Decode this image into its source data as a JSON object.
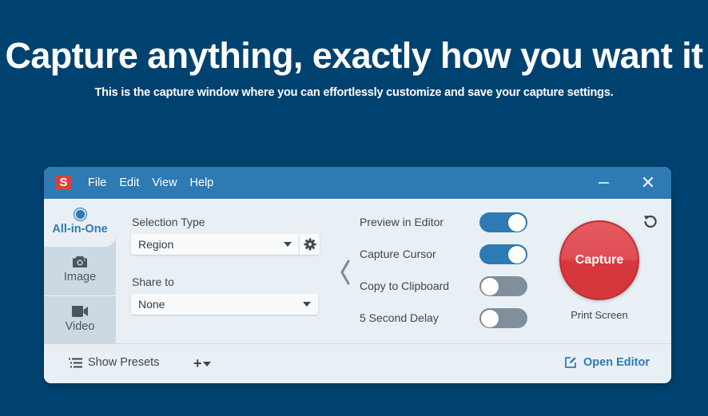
{
  "hero": {
    "title": "Capture anything, exactly how you want it",
    "subtitle": "This is the capture window where you can effortlessly customize and save your capture settings."
  },
  "window": {
    "app_icon": "snagit-logo-icon",
    "app_icon_letter": "S",
    "menu": [
      "File",
      "Edit",
      "View",
      "Help"
    ],
    "controls": {
      "minimize": "minimize-icon",
      "close": "close-icon",
      "close_glyph": "✕"
    }
  },
  "tabs": [
    {
      "label": "All-in-One",
      "icon": "radio-icon",
      "active": true
    },
    {
      "label": "Image",
      "icon": "camera-icon",
      "active": false
    },
    {
      "label": "Video",
      "icon": "video-camera-icon",
      "active": false
    }
  ],
  "settings": {
    "selection_type": {
      "label": "Selection Type",
      "value": "Region",
      "gear_icon": "gear-icon"
    },
    "share_to": {
      "label": "Share to",
      "value": "None"
    }
  },
  "options": [
    {
      "label": "Preview in Editor",
      "on": true
    },
    {
      "label": "Capture Cursor",
      "on": true
    },
    {
      "label": "Copy to Clipboard",
      "on": false
    },
    {
      "label": "5 Second Delay",
      "on": false
    }
  ],
  "capture": {
    "button_label": "Capture",
    "hotkey": "Print Screen",
    "reset_icon": "reset-icon"
  },
  "footer": {
    "show_presets": "Show Presets",
    "add_preset_glyph": "+",
    "open_editor": "Open Editor"
  },
  "colors": {
    "page_background": "#00426f",
    "titlebar": "#2e7ab3",
    "accent": "#2e7ab3",
    "capture_red": "#e04e54",
    "toggle_off": "#808f99",
    "window_bg": "#e8f0f6"
  }
}
